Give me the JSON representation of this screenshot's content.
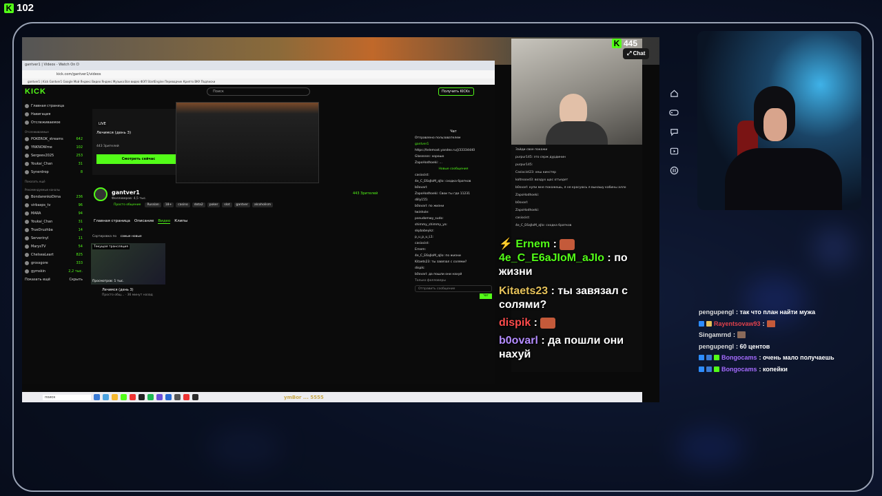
{
  "top_badge": {
    "count": "102",
    "icon": "kick-logo-icon"
  },
  "browser": {
    "tab_text": "gantver1 | Videos - Watch On D",
    "url": "kick.com/gantver1/videos",
    "bookmarks": "gantver1 | Kick  Gantver1  Google  Мой Яндекс  Видео  Яндекс Музыка  Все видео  ФЭП  StartEngine  Переводчик  Крипто  ВКУ  Подписки"
  },
  "kick": {
    "logo": "KICK",
    "search_placeholder": "Поиск",
    "login_label": "Получить KICKs",
    "sidebar_top": [
      "Главная страница",
      "Навигация",
      "Отслеживаемое"
    ],
    "followed_heading": "Отслеживаемые",
    "followed": [
      {
        "name": "POKEROK_streams",
        "count": "642"
      },
      {
        "name": "YNKNOWme",
        "count": "102"
      },
      {
        "name": "Sergeev2025",
        "count": "253"
      },
      {
        "name": "Youkai_Chan",
        "count": "31"
      },
      {
        "name": "Synerdrop",
        "count": "8"
      }
    ],
    "show_more": "Показать ещё",
    "recommended_heading": "Рекомендуемые каналы",
    "recommended": [
      {
        "name": "BondarenkoDima",
        "count": "236"
      },
      {
        "name": "virbasps_tv",
        "count": "96"
      },
      {
        "name": "MARA",
        "count": "94"
      },
      {
        "name": "Youkai_Chan",
        "count": "31"
      },
      {
        "name": "TrueDruzhba",
        "count": "14"
      },
      {
        "name": "Serverinyl",
        "count": "11"
      },
      {
        "name": "MarysTV",
        "count": "54"
      },
      {
        "name": "ChelseaLeart",
        "count": "825"
      },
      {
        "name": "grossgore",
        "count": "333"
      },
      {
        "name": "gymskin",
        "count": "2,2 тыс."
      }
    ],
    "sidebar_footer": [
      "Показать ещё",
      "Скрыть"
    ],
    "offline": {
      "live": "LIVE",
      "title": "Лечимся (день 3)",
      "viewers": "443 Зрителей",
      "watch_button": "Смотреть сейчас"
    },
    "channel": {
      "name": "gantver1",
      "followers": "Фолловеров: 4,5 тыс.",
      "category": "Просто общение",
      "viewers": "443 Зрителей"
    },
    "tags": [
      "Russian",
      "18+",
      "casino",
      "dota2",
      "poker",
      "slot",
      "gantver",
      "alcoholism"
    ],
    "tabs": [
      "Главная страница",
      "Описание",
      "Видео",
      "Клипы"
    ],
    "active_tab": "Видео",
    "sort_label": "Сортировка по",
    "sort_value": "самые новые",
    "video": {
      "badge": "Текущая трансляция",
      "views": "Просмотров: 1 тыс.",
      "title": "Лечимся (день 3)",
      "meta": "Просто общ... · 36 минут назад"
    },
    "chat_title": "Чат",
    "chat_lines": [
      "Отправлено пользователем",
      "gantver1",
      "https://telemost.yandex.ru/j/33334440",
      "Glassssss: хорошо",
      "ZapoHodhoeki: ..."
    ],
    "new_messages": "Новые сообщения",
    "chat_lines_2": [
      "casiocist:",
      "4e_C_E6aJIoM_aJIo: сходка братков",
      "b0ovarl:",
      "ZapoHodhoeki: Свои ты где 11231",
      "dilly155:",
      "b0ovarl: по жизни",
      "twinhole:",
      "pseudomwy_sudo:",
      "shimmy_shimmy_ya:",
      "skybabeykz:",
      "p_u_p_u_L1:",
      "casiocist:",
      "Ernem:",
      "4e_C_E6aJIoM_aJIo: по жизни",
      "Kitaets23: ты завязал с солями?",
      "dispik:",
      "b0ovarl: да пошли они нахуй"
    ],
    "chat_placeholder": "Отправить сообщение",
    "chat_send": "Чат",
    "chat_only_followers": "Только фолловеры"
  },
  "taskbar": {
    "search": "поиск",
    "ticker": "ymBor ... 5555"
  },
  "embedded": {
    "count": "445",
    "chat_pill": "Chat",
    "url": "kick.com/gantver1/videos"
  },
  "embedded_chat_small": [
    "Зайди свое покажи",
    "purpur145: это серж дурдинин",
    "purpur145:",
    "Casiocist23: хеш кинстер",
    "koltnoovd3: воздух щас отъедет",
    "b0ovarl: купи мне покажешь, я не красуюсь я вынашу кабины алло",
    "ZapoHodhoeki:",
    "b0ovarl:",
    "ZapoHodhoeki:",
    "casiocist:",
    "4e_C_E6aJIoM_aJIo: сходка братков"
  ],
  "big_chat": [
    {
      "user": "Ernem",
      "sep": " :",
      "text": "",
      "color": "green"
    },
    {
      "user": "4e_C_E6aJIoM_aJIo",
      "sep": " :",
      "text": " по жизни",
      "color": "green"
    },
    {
      "user": "Kitaets23",
      "sep": " :",
      "text": " ты завязал с солями?",
      "color": "gold"
    },
    {
      "user": "dispik",
      "sep": " :",
      "text": "",
      "color": "red"
    },
    {
      "user": "b0ovarl",
      "sep": " :",
      "text": " да пошли они нахуй",
      "color": "purple"
    }
  ],
  "overlay_chat": [
    {
      "user": "pengupengl",
      "text": ": так что план найти мужа",
      "color": "plain"
    },
    {
      "user": "Rayentsovaw93",
      "text": ":",
      "color": "red"
    },
    {
      "user": "Singamrnd",
      "text": ":",
      "color": "plain"
    },
    {
      "user": "pengupengl",
      "text": ": 60 центов",
      "color": "plain"
    },
    {
      "user": "Bongocams",
      "text": ": очень мало получаешь",
      "color": "purple"
    },
    {
      "user": "Bongocams",
      "text": ": копейки",
      "color": "purple"
    }
  ],
  "rail_icons": [
    "home-icon",
    "gamepad-icon",
    "chat-icon",
    "video-icon",
    "pause-icon"
  ],
  "colors": {
    "kick_green": "#53fc18",
    "background": "#0d1630"
  }
}
